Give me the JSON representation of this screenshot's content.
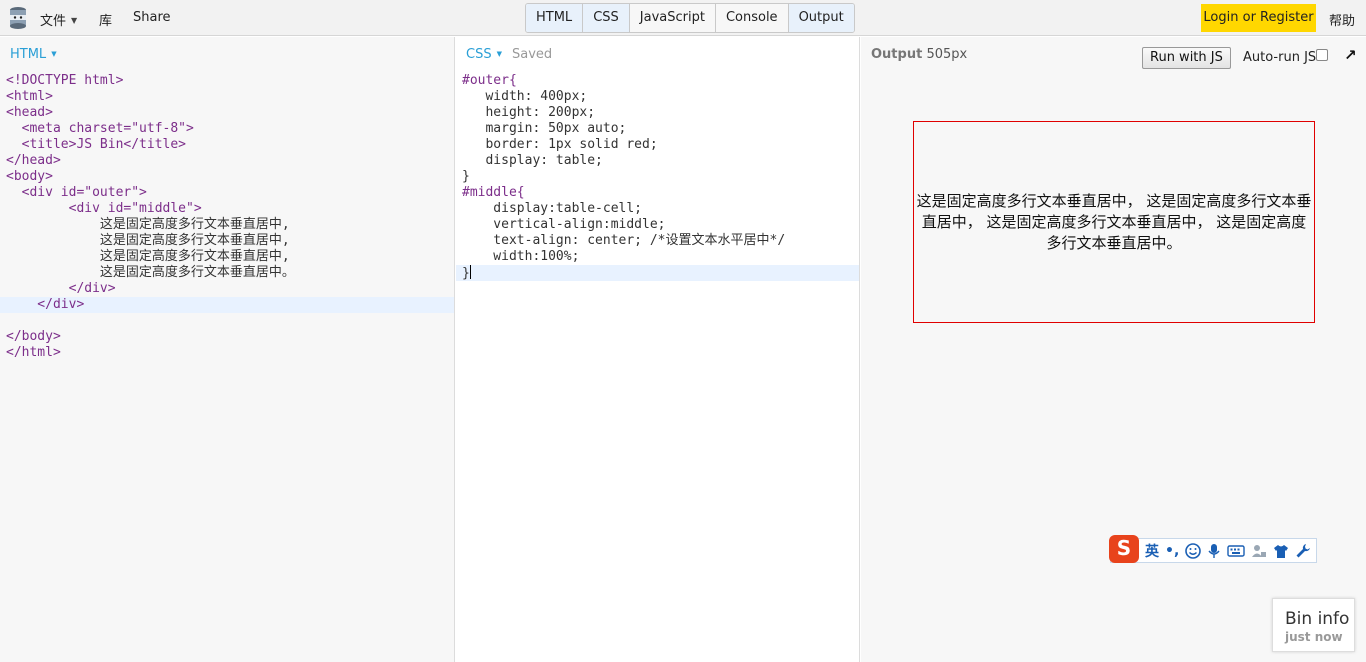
{
  "topbar": {
    "menu_file": "文件",
    "menu_library": "库",
    "menu_share": "Share",
    "tabs": [
      "HTML",
      "CSS",
      "JavaScript",
      "Console",
      "Output"
    ],
    "login": "Login or Register",
    "help": "帮助"
  },
  "html_panel": {
    "label": "HTML",
    "lines": [
      "<!DOCTYPE html>",
      "<html>",
      "<head>",
      "  <meta charset=\"utf-8\">",
      "  <title>JS Bin</title>",
      "</head>",
      "<body>",
      "  <div id=\"outer\">",
      "        <div id=\"middle\">",
      "            这是固定高度多行文本垂直居中,",
      "            这是固定高度多行文本垂直居中,",
      "            这是固定高度多行文本垂直居中,",
      "            这是固定高度多行文本垂直居中。",
      "        </div>",
      "    </div>",
      "",
      "</body>",
      "</html>"
    ]
  },
  "css_panel": {
    "label": "CSS",
    "status": "Saved",
    "lines": [
      "#outer{",
      "   width: 400px;",
      "   height: 200px;",
      "   margin: 50px auto;",
      "   border: 1px solid red;",
      "   display: table;",
      "}",
      "#middle{",
      "    display:table-cell;",
      "    vertical-align:middle;",
      "    text-align: center; /*设置文本水平居中*/",
      "    width:100%;",
      "}"
    ]
  },
  "output_panel": {
    "title": "Output",
    "size": "505px",
    "run_button": "Run with JS",
    "auto_run": "Auto-run JS",
    "auto_run_checked": false,
    "rendered_text": "这是固定高度多行文本垂直居中， 这是固定高度多行文本垂直居中， 这是固定高度多行文本垂直居中， 这是固定高度多行文本垂直居中。",
    "box_border_color": "#e00000"
  },
  "ime_toolbar": {
    "logo": "S",
    "lang": "英",
    "punct": "•,",
    "icons": [
      "smiley-icon",
      "microphone-icon",
      "keyboard-icon",
      "user-icon",
      "shirt-icon",
      "wrench-icon"
    ]
  },
  "bin_info": {
    "title": "Bin info",
    "subtitle": "just now"
  },
  "colors": {
    "accent_blue": "#2a9fd6",
    "login_yellow": "#ffd700"
  }
}
